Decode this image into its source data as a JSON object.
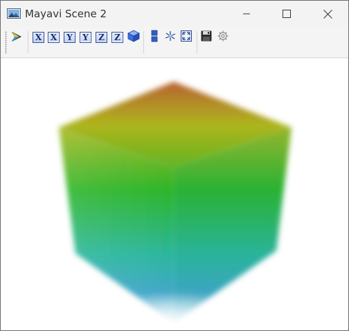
{
  "window": {
    "title": "Mayavi Scene 2",
    "icon": "landscape-image-icon",
    "controls": [
      "minimize-icon",
      "maximize-icon",
      "close-icon"
    ]
  },
  "toolbar": {
    "buttons": [
      {
        "name": "mayavi-pipeline-button",
        "icon": "mayavi-logo-icon"
      },
      {
        "name": "view-along-x-plus",
        "label": "X"
      },
      {
        "name": "view-along-x-minus",
        "label": "X"
      },
      {
        "name": "view-along-y-plus",
        "label": "Y"
      },
      {
        "name": "view-along-y-minus",
        "label": "Y"
      },
      {
        "name": "view-along-z-plus",
        "label": "Z"
      },
      {
        "name": "view-along-z-minus",
        "label": "Z"
      },
      {
        "name": "isometric-view",
        "icon": "cube-icon"
      },
      {
        "name": "parallel-projection",
        "icon": "parallel-bars-icon"
      },
      {
        "name": "toggle-axes",
        "icon": "axes-icon"
      },
      {
        "name": "full-screen",
        "icon": "fullscreen-icon"
      },
      {
        "name": "save-scene",
        "icon": "floppy-disk-icon"
      },
      {
        "name": "configure-scene",
        "icon": "gear-icon"
      }
    ]
  },
  "scene": {
    "content": "volume-rendered-cube",
    "colors": {
      "top": "#b4552a",
      "upper": "#a8b514",
      "middle": "#23b21f",
      "lower": "#22b39a",
      "bottom": "#3aa3c8"
    }
  }
}
